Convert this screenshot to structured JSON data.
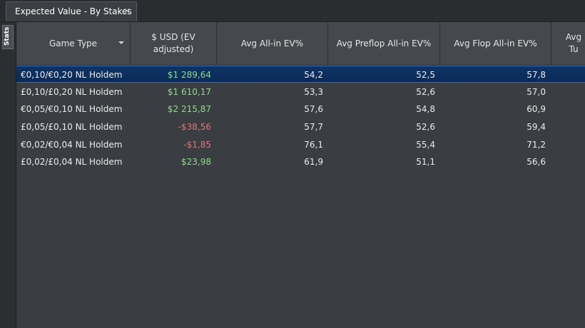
{
  "tab": {
    "title": "Expected Value - By Stakes",
    "close": "×"
  },
  "sidebar": {
    "label": "Stats"
  },
  "columns": [
    "Game Type",
    "$ USD (EV adjusted)",
    "Avg All-in EV%",
    "Avg Preflop All-in EV%",
    "Avg Flop All-in EV%",
    "Avg Tu"
  ],
  "rows": [
    {
      "game": "€0,10/€0,20 NL Holdem",
      "usd": "$1 289,64",
      "ev_allin": "54,2",
      "ev_preflop": "52,5",
      "ev_flop": "57,8",
      "selected": true,
      "sign": "pos"
    },
    {
      "game": "£0,10/£0,20 NL Holdem",
      "usd": "$1 610,17",
      "ev_allin": "53,3",
      "ev_preflop": "52,6",
      "ev_flop": "57,0",
      "selected": false,
      "sign": "pos"
    },
    {
      "game": "€0,05/€0,10 NL Holdem",
      "usd": "$2 215,87",
      "ev_allin": "57,6",
      "ev_preflop": "54,8",
      "ev_flop": "60,9",
      "selected": false,
      "sign": "pos"
    },
    {
      "game": "£0,05/£0,10 NL Holdem",
      "usd": "-$38,56",
      "ev_allin": "57,7",
      "ev_preflop": "52,6",
      "ev_flop": "59,4",
      "selected": false,
      "sign": "neg"
    },
    {
      "game": "€0,02/€0,04 NL Holdem",
      "usd": "-$1,85",
      "ev_allin": "76,1",
      "ev_preflop": "55,4",
      "ev_flop": "71,2",
      "selected": false,
      "sign": "neg"
    },
    {
      "game": "£0,02/£0,04 NL Holdem",
      "usd": "$23,98",
      "ev_allin": "61,9",
      "ev_preflop": "51,1",
      "ev_flop": "56,6",
      "selected": false,
      "sign": "pos"
    }
  ],
  "colors": {
    "positive": "#8fdc8a",
    "negative": "#e07676",
    "selection": "#0d3468"
  }
}
